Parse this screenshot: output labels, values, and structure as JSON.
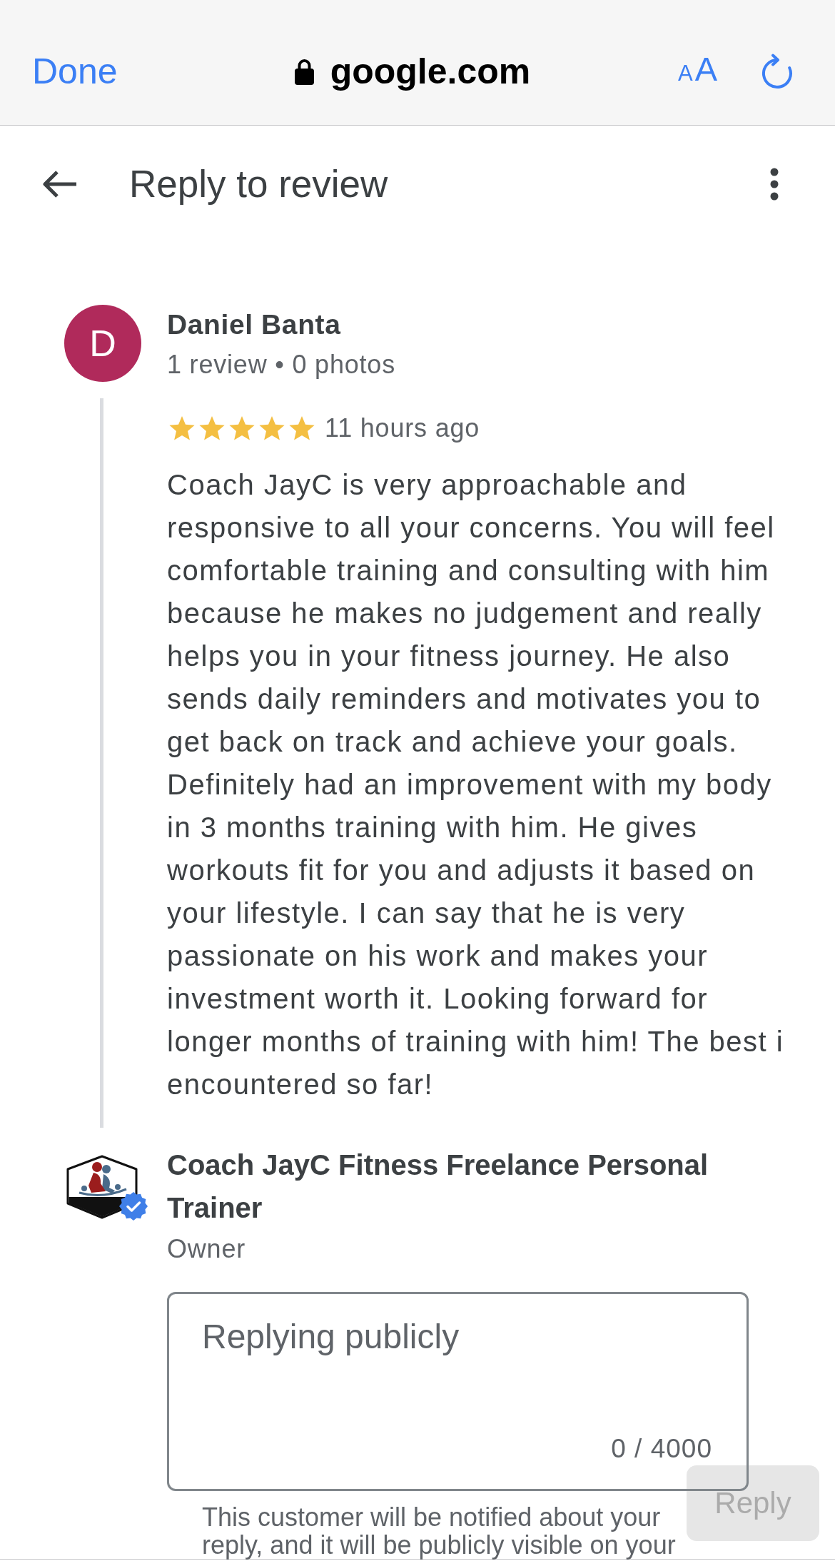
{
  "browser_bar": {
    "done": "Done",
    "domain": "google.com",
    "text_size": {
      "small": "A",
      "large": "A"
    }
  },
  "header": {
    "title": "Reply to review"
  },
  "review": {
    "avatar_letter": "D",
    "author": "Daniel Banta",
    "author_meta": "1 review • 0 photos",
    "stars": 5,
    "time": "11 hours ago",
    "text": "Coach JayC is very approachable and responsive to all your concerns. You will feel comfortable training and consulting with him because he makes no judgement and really helps you in your fitness journey. He also sends daily reminders and motivates you to get back on track and achieve your goals. Definitely had an improvement with my body in 3 months training with him. He gives workouts fit for you and adjusts it based on your lifestyle. I can say that he is very passionate on his work and makes your investment worth it. Looking forward for longer months of training with him! The best i encountered so far!"
  },
  "owner": {
    "name": "Coach JayC Fitness Freelance Personal Trainer",
    "verified": true,
    "role": "Owner"
  },
  "reply_form": {
    "placeholder": "Replying publicly",
    "counter": "0 / 4000",
    "reply_button": {
      "label": "Reply",
      "disabled": true
    },
    "notice": "This customer will be notified about your reply, and it will be publicly visible on your"
  }
}
